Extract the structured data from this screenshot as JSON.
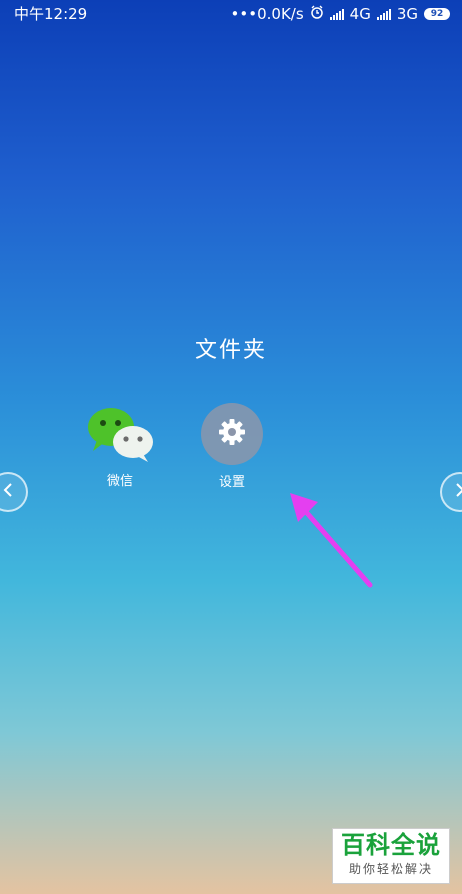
{
  "status_bar": {
    "time": "中午12:29",
    "net_speed": "•••0.0K/s",
    "network_1": "4G",
    "network_2": "3G",
    "battery": "92",
    "icons": [
      "alarm-icon",
      "signal-icon",
      "signal-icon",
      "battery-icon"
    ]
  },
  "folder": {
    "title": "文件夹",
    "apps": [
      {
        "label": "微信",
        "icon": "wechat-icon"
      },
      {
        "label": "设置",
        "icon": "gear-icon"
      }
    ]
  },
  "nav": {
    "left_icon": "chevron-left-icon",
    "right_icon": "chevron-right-icon"
  },
  "annotation": {
    "arrow_color": "#e43ff0"
  },
  "watermark": {
    "title": "百科全说",
    "subtitle": "助你轻松解决"
  }
}
